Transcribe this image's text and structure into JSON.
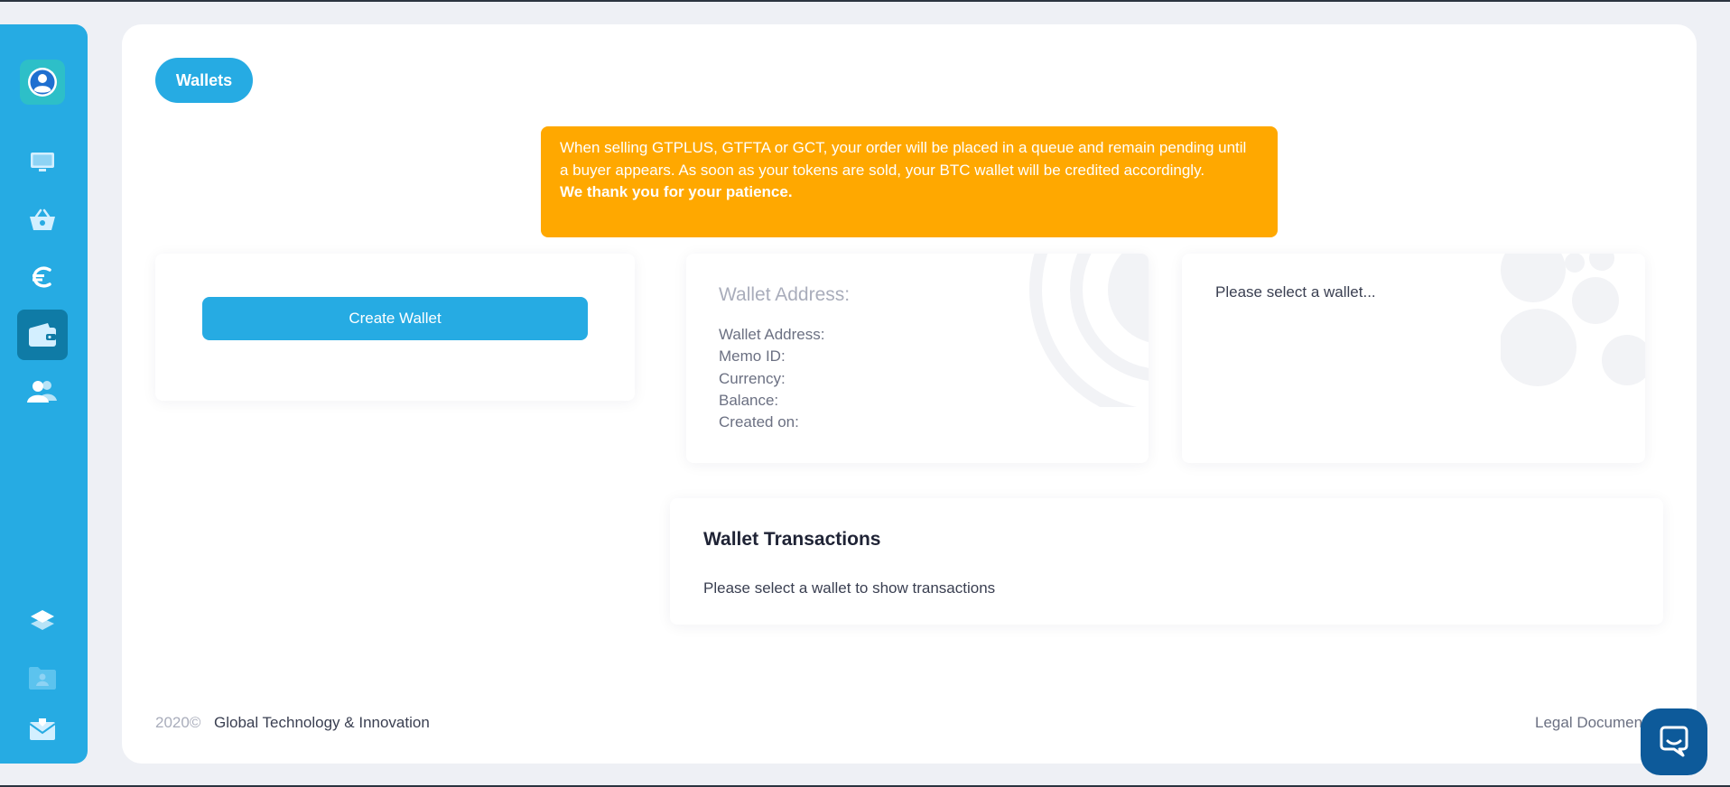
{
  "sidebar": {
    "items": [
      {
        "icon": "user-avatar-icon"
      },
      {
        "icon": "monitor-icon"
      },
      {
        "icon": "basket-icon"
      },
      {
        "icon": "euro-icon"
      },
      {
        "icon": "wallet-icon",
        "active": true
      },
      {
        "icon": "users-icon"
      },
      {
        "icon": "layers-icon"
      },
      {
        "icon": "folder-user-icon"
      },
      {
        "icon": "mail-icon"
      }
    ],
    "color": "#26abe3",
    "active_color": "#0f7ba6"
  },
  "header": {
    "wallets_label": "Wallets"
  },
  "notice": {
    "text": "When selling GTPLUS, GTFTA or GCT, your order will be placed in a queue and remain pending until a buyer appears. As soon as your tokens are sold, your BTC wallet will be credited accordingly.",
    "strong": "We thank you for your patience.",
    "color": "#ffa800"
  },
  "create_wallet": {
    "button_label": "Create Wallet"
  },
  "wallet_address": {
    "title": "Wallet Address:",
    "fields": [
      "Wallet Address:",
      "Memo ID:",
      "Currency:",
      "Balance:",
      "Created on:"
    ]
  },
  "wallet_select": {
    "message": "Please select a wallet..."
  },
  "transactions": {
    "title": "Wallet Transactions",
    "message": "Please select a wallet to show transactions"
  },
  "footer": {
    "year": "2020©",
    "company": "Global Technology & Innovation",
    "legal": "Legal Documents"
  },
  "chat": {
    "icon": "chat-bubble-icon",
    "color": "#0d5a9a"
  }
}
